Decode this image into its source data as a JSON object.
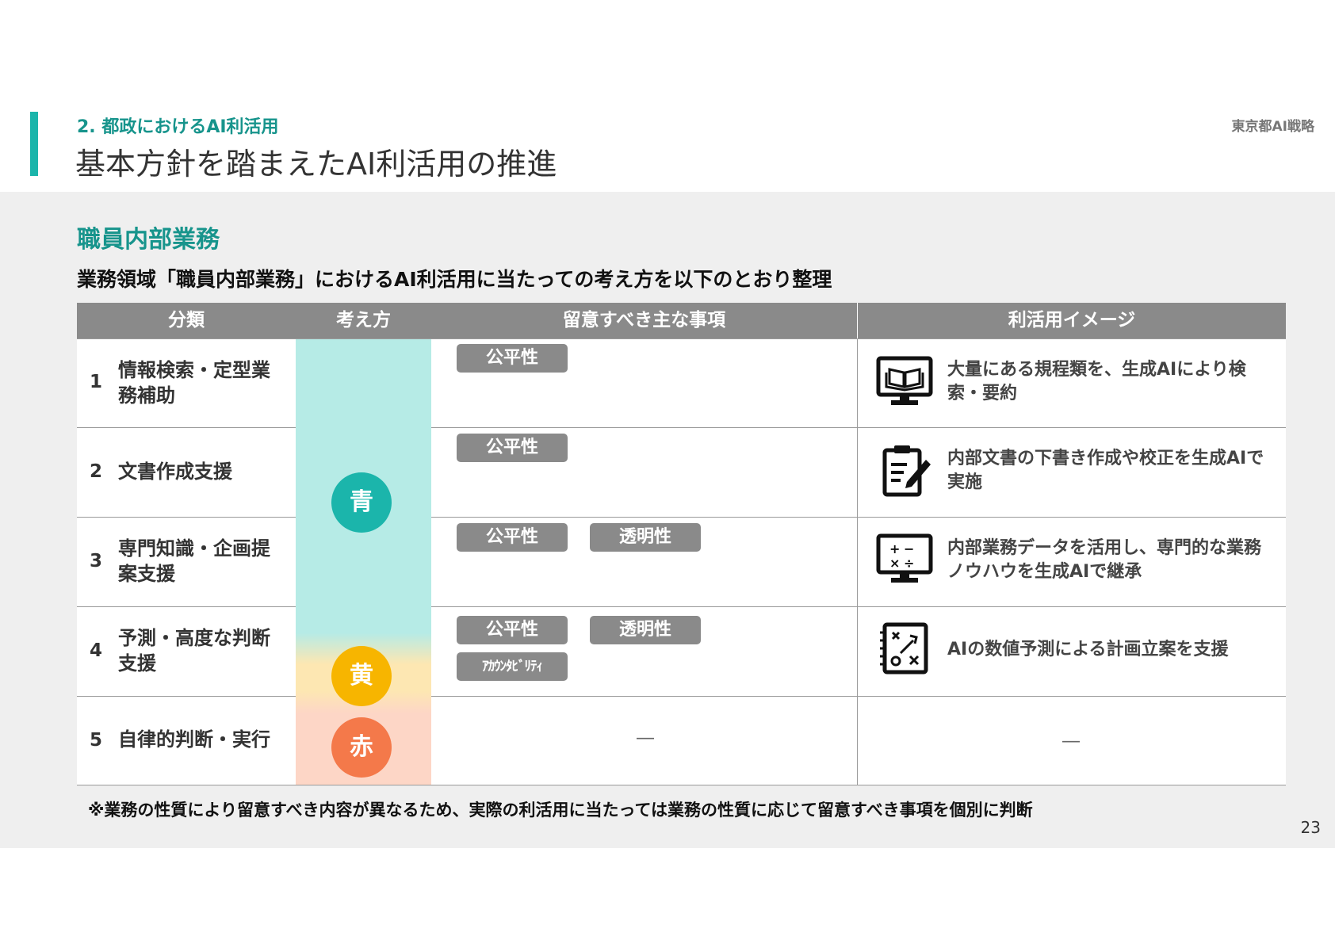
{
  "header": {
    "section_label": "2. 都政におけるAI利活用",
    "title": "基本方針を踏まえたAI利活用の推進",
    "doc_label": "東京都AI戦略"
  },
  "content": {
    "sub_heading": "職員内部業務",
    "lead": "業務領域「職員内部業務」におけるAI利活用に当たっての考え方を以下のとおり整理"
  },
  "table": {
    "headers": {
      "category": "分類",
      "approach": "考え方",
      "notes": "留意すべき主な事項",
      "usage": "利活用イメージ"
    },
    "approach_levels": [
      {
        "label": "青",
        "color": "#1bb5ab"
      },
      {
        "label": "黄",
        "color": "#f7b500"
      },
      {
        "label": "赤",
        "color": "#f4794a"
      }
    ],
    "rows": [
      {
        "num": "1",
        "category": "情報検索・定型業務補助",
        "tags": [
          "公平性"
        ],
        "usage": "大量にある規程類を、生成AIにより検索・要約",
        "icon": "monitor-book-icon"
      },
      {
        "num": "2",
        "category": "文書作成支援",
        "tags": [
          "公平性"
        ],
        "usage": "内部文書の下書き作成や校正を生成AIで実施",
        "icon": "clipboard-pen-icon"
      },
      {
        "num": "3",
        "category": "専門知識・企画提案支援",
        "tags": [
          "公平性",
          "透明性"
        ],
        "usage": "内部業務データを活用し、専門的な業務ノウハウを生成AIで継承",
        "icon": "monitor-calculator-icon"
      },
      {
        "num": "4",
        "category": "予測・高度な判断支援",
        "tags": [
          "公平性",
          "透明性",
          "ｱｶｳﾝﾀﾋﾞﾘﾃｨ"
        ],
        "usage": "AIの数値予測による計画立案を支援",
        "icon": "strategy-board-icon"
      },
      {
        "num": "5",
        "category": "自律的判断・実行",
        "notes_dash": "―",
        "usage_dash": "―"
      }
    ]
  },
  "footnote": "※業務の性質により留意すべき内容が異なるため、実際の利活用に当たっては業務の性質に応じて留意すべき事項を個別に判断",
  "page_number": "23"
}
